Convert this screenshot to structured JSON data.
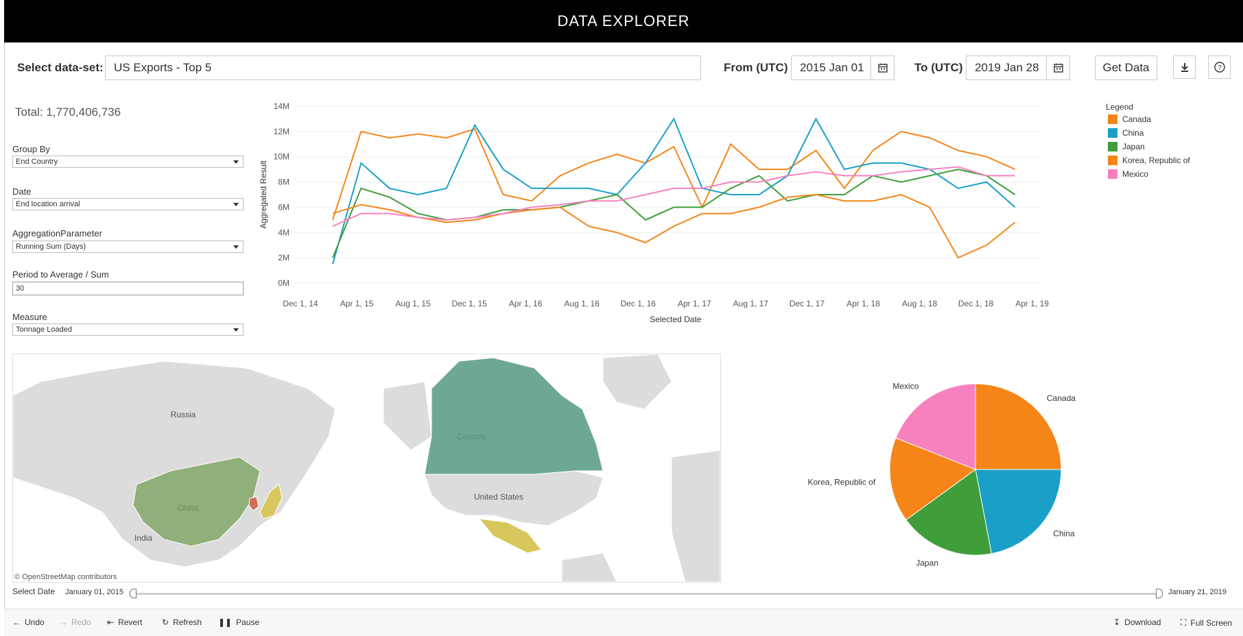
{
  "app": {
    "title": "DATA EXPLORER"
  },
  "topbar": {
    "dataset_label": "Select data-set:",
    "dataset_value": "US Exports - Top 5",
    "from_label": "From (UTC)",
    "from_value": "2015 Jan 01",
    "to_label": "To (UTC)",
    "to_value": "2019 Jan 28",
    "get_data_label": "Get Data",
    "download_icon": "download-icon",
    "help_icon": "help-icon"
  },
  "summary": {
    "total": "Total: 1,770,406,736"
  },
  "filters": {
    "group_by": {
      "label": "Group By",
      "value": "End Country"
    },
    "date": {
      "label": "Date",
      "value": "End location arrival"
    },
    "aggregation": {
      "label": "AggregationParameter",
      "value": "Running Sum (Days)"
    },
    "period": {
      "label": "Period to Average / Sum",
      "value": "30"
    },
    "measure": {
      "label": "Measure",
      "value": "Tonnage Loaded"
    }
  },
  "colors": {
    "canada": "#f58518",
    "china": "#1aa0c8",
    "japan": "#3f9e3a",
    "korea": "#f58518",
    "mexico": "#f781bf"
  },
  "chart_data": [
    {
      "type": "line",
      "xlabel": "Selected Date",
      "ylabel": "Aggregated Result",
      "x_ticks": [
        "Dec 1, 14",
        "Apr 1, 15",
        "Aug 1, 15",
        "Dec 1, 15",
        "Apr 1, 16",
        "Aug 1, 16",
        "Dec 1, 16",
        "Apr 1, 17",
        "Aug 1, 17",
        "Dec 1, 17",
        "Apr 1, 18",
        "Aug 1, 18",
        "Dec 1, 18",
        "Apr 1, 19"
      ],
      "y_ticks": [
        "0M",
        "2M",
        "4M",
        "6M",
        "8M",
        "10M",
        "12M",
        "14M"
      ],
      "ylim": [
        0,
        14000000
      ],
      "grid": true,
      "legend_title": "Legend",
      "legend_position": "right",
      "x": [
        "2015-01",
        "2015-03",
        "2015-05",
        "2015-07",
        "2015-09",
        "2015-11",
        "2016-01",
        "2016-03",
        "2016-05",
        "2016-07",
        "2016-09",
        "2016-11",
        "2017-01",
        "2017-03",
        "2017-05",
        "2017-07",
        "2017-09",
        "2017-11",
        "2018-01",
        "2018-03",
        "2018-05",
        "2018-07",
        "2018-09",
        "2018-11",
        "2019-01"
      ],
      "series": [
        {
          "name": "Canada",
          "color": "#f58518",
          "values": [
            5.0,
            12.0,
            11.5,
            11.8,
            11.5,
            12.2,
            7.0,
            6.5,
            8.5,
            9.5,
            10.2,
            9.5,
            10.8,
            6.0,
            11.0,
            9.0,
            9.0,
            10.5,
            7.5,
            10.5,
            12.0,
            11.5,
            10.5,
            10.0,
            9.0
          ]
        },
        {
          "name": "China",
          "color": "#1aa0c8",
          "values": [
            1.5,
            9.5,
            7.5,
            7.0,
            7.5,
            12.5,
            9.0,
            7.5,
            7.5,
            7.5,
            7.0,
            9.5,
            13.0,
            7.5,
            7.0,
            7.0,
            8.5,
            13.0,
            9.0,
            9.5,
            9.5,
            9.0,
            7.5,
            8.0,
            6.0
          ]
        },
        {
          "name": "Japan",
          "color": "#3f9e3a",
          "values": [
            2.0,
            7.5,
            6.8,
            5.5,
            5.0,
            5.2,
            5.8,
            5.8,
            6.0,
            6.5,
            7.0,
            5.0,
            6.0,
            6.0,
            7.5,
            8.5,
            6.5,
            7.0,
            7.0,
            8.5,
            8.0,
            8.5,
            9.0,
            8.5,
            7.0
          ]
        },
        {
          "name": "Korea, Republic of",
          "color": "#f58518",
          "values": [
            5.5,
            6.2,
            5.8,
            5.2,
            4.8,
            5.0,
            5.5,
            5.8,
            6.0,
            4.5,
            4.0,
            3.2,
            4.5,
            5.5,
            5.5,
            6.0,
            6.8,
            7.0,
            6.5,
            6.5,
            7.0,
            6.0,
            2.0,
            3.0,
            4.8
          ]
        },
        {
          "name": "Mexico",
          "color": "#f781bf",
          "values": [
            4.5,
            5.5,
            5.5,
            5.2,
            5.0,
            5.2,
            5.5,
            6.0,
            6.2,
            6.5,
            6.5,
            7.0,
            7.5,
            7.5,
            8.0,
            8.0,
            8.5,
            8.8,
            8.5,
            8.5,
            8.8,
            9.0,
            9.2,
            8.5,
            8.5
          ]
        }
      ]
    },
    {
      "type": "pie",
      "categories": [
        "Canada",
        "China",
        "Japan",
        "Korea, Republic of",
        "Mexico"
      ],
      "values": [
        25,
        22,
        18,
        16,
        19
      ],
      "colors": [
        "#f58518",
        "#1aa0c8",
        "#3f9e3a",
        "#f58518",
        "#f781bf"
      ]
    }
  ],
  "map": {
    "attribution": "© OpenStreetMap contributors",
    "labels": {
      "russia": "Russia",
      "china": "China",
      "india": "India",
      "canada": "Canada",
      "us": "United States"
    }
  },
  "slider": {
    "label": "Select Date",
    "start": "January 01, 2015",
    "end": "January 21, 2019"
  },
  "toolbar": {
    "undo": "Undo",
    "redo": "Redo",
    "revert": "Revert",
    "refresh": "Refresh",
    "pause": "Pause",
    "download": "Download",
    "fullscreen": "Full Screen"
  }
}
